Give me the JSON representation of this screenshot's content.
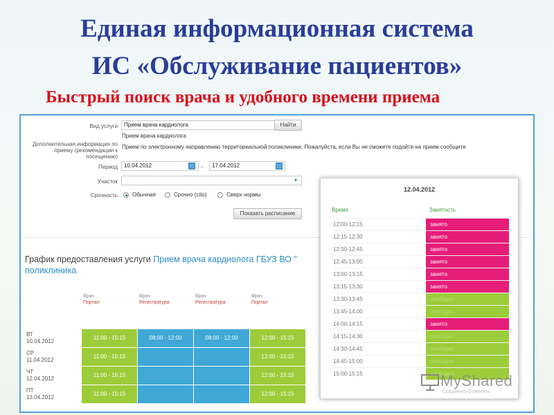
{
  "slide": {
    "title_line1": "Единая информационная система",
    "title_line2": "ИС «Обслуживание пациентов»",
    "subtitle": "Быстрый поиск врача и удобного времени приема"
  },
  "form": {
    "service_type_label": "Вид услуги",
    "service_type_value": "Прием врача кардиолога",
    "find_button": "Найти",
    "service_hint": "Прием врача кардиолога",
    "extra_info_label": "Дополнительная информация по приему (рекомендации к посещению)",
    "extra_info_text": "Прием по электронному направлению территориальной поликлиники. Пожалуйста, если Вы не сможете подойти на прием сообщите",
    "period_label": "Период",
    "period_from": "10.04.2012",
    "period_dash": "-",
    "period_to": "17.04.2012",
    "district_label": "Участок",
    "district_value": "",
    "urgency_label": "Срочность",
    "urgency_options": [
      "Обычная",
      "Срочно (cito)",
      "Сверх нормы"
    ],
    "urgency_selected": "Обычная",
    "show_schedule_button": "Показать расписание"
  },
  "schedule": {
    "heading_prefix": "График предоставления услуги",
    "heading_service": "Прием врача кардиолога ГБУЗ ВО \"",
    "heading_line2": "поликлиника",
    "doctors": [
      {
        "name": "Врач",
        "source": "Портал"
      },
      {
        "name": "Врач",
        "source": "Регистратура"
      },
      {
        "name": "Врач",
        "source": "Регистратура"
      },
      {
        "name": "Врач",
        "source": "Портал"
      }
    ],
    "days": [
      {
        "day": "ВТ",
        "date": "10.04.2012",
        "cells": [
          {
            "text": "11:00 - 15:15",
            "color": "green"
          },
          {
            "text": "08:00 - 12:00",
            "color": "blue"
          },
          {
            "text": "08:00 - 12:00",
            "color": "blue"
          },
          {
            "text": "12:00 - 15:15",
            "color": "green"
          }
        ]
      },
      {
        "day": "СР",
        "date": "11.04.2012",
        "cells": [
          {
            "text": "11:00 - 15:15",
            "color": "green"
          },
          {
            "text": "",
            "color": "blue"
          },
          {
            "text": "",
            "color": "blue"
          },
          {
            "text": "12:00 - 15:15",
            "color": "green"
          }
        ]
      },
      {
        "day": "ЧТ",
        "date": "12.04.2012",
        "cells": [
          {
            "text": "11:00 - 15:15",
            "color": "green"
          },
          {
            "text": "",
            "color": "blue"
          },
          {
            "text": "",
            "color": "blue"
          },
          {
            "text": "12:00 - 15:15",
            "color": "green"
          }
        ]
      },
      {
        "day": "ПТ",
        "date": "13.04.2012",
        "cells": [
          {
            "text": "11:00 - 15:15",
            "color": "green"
          },
          {
            "text": "",
            "color": "blue"
          },
          {
            "text": "",
            "color": "blue"
          },
          {
            "text": "12:00 - 15:15",
            "color": "green"
          }
        ]
      }
    ]
  },
  "popup": {
    "date": "12.04.2012",
    "col_time": "Время",
    "col_status": "Занятость",
    "busy_label": "занято",
    "free_label": "свободно",
    "slots": [
      {
        "time": "12:00-12:15",
        "status": "busy"
      },
      {
        "time": "12:15-12:30",
        "status": "busy"
      },
      {
        "time": "12:30-12:45",
        "status": "busy"
      },
      {
        "time": "12:45-13:00",
        "status": "busy"
      },
      {
        "time": "13:00-13:15",
        "status": "busy"
      },
      {
        "time": "13:15-13:30",
        "status": "busy"
      },
      {
        "time": "13:30-13:45",
        "status": "free"
      },
      {
        "time": "13:45-14:00",
        "status": "free"
      },
      {
        "time": "14:00-14:15",
        "status": "busy"
      },
      {
        "time": "14:15-14:30",
        "status": "free"
      },
      {
        "time": "14:30-14:45",
        "status": "free"
      },
      {
        "time": "14:45-15:00",
        "status": "free"
      },
      {
        "time": "15:00-15:15",
        "status": "free"
      }
    ],
    "footer_text": "Сохранить    Отменить"
  },
  "watermark": {
    "brand": "MyShared",
    "icon": "presentation-icon"
  },
  "colors": {
    "title": "#2a3d9a",
    "subtitle": "#d8101c",
    "busy": "#e51d78",
    "free": "#9ccc3a",
    "registry": "#3fa8d6",
    "frame": "#53a0d8"
  }
}
